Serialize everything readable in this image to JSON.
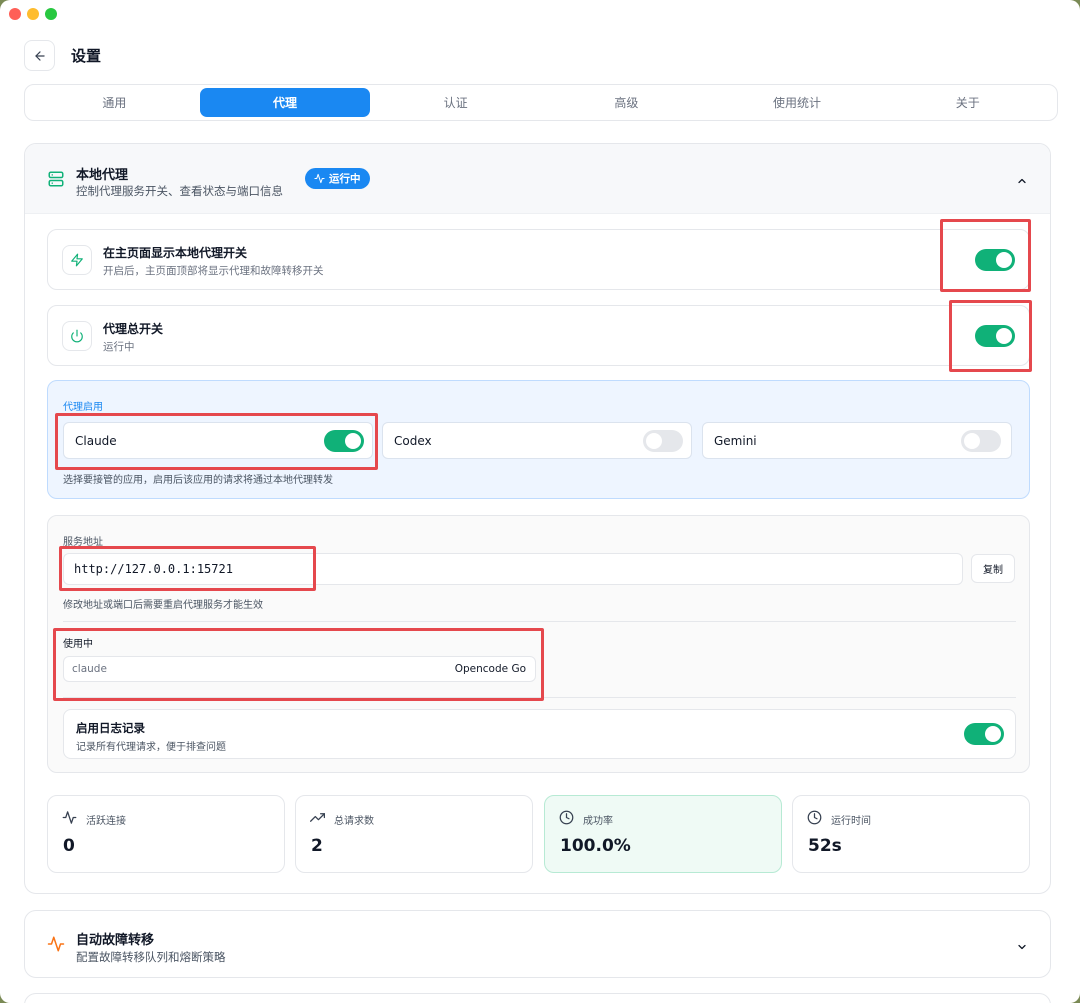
{
  "window": {
    "title": "设置"
  },
  "header": {
    "back_icon": "arrow-left-icon",
    "title": "设置"
  },
  "tabs": [
    {
      "label": "通用",
      "active": false
    },
    {
      "label": "代理",
      "active": true
    },
    {
      "label": "认证",
      "active": false
    },
    {
      "label": "高级",
      "active": false
    },
    {
      "label": "使用统计",
      "active": false
    },
    {
      "label": "关于",
      "active": false
    }
  ],
  "local_proxy": {
    "icon": "server-icon",
    "title": "本地代理",
    "subtitle": "控制代理服务开关、查看状态与端口信息",
    "badge": "运行中",
    "show_toggle": {
      "icon": "zap-icon",
      "title": "在主页面显示本地代理开关",
      "subtitle": "开启后，主页面顶部将显示代理和故障转移开关",
      "enabled": true
    },
    "master_switch": {
      "icon": "power-icon",
      "title": "代理总开关",
      "subtitle": "运行中",
      "enabled": true
    },
    "apps": {
      "label": "代理启用",
      "items": [
        {
          "name": "Claude",
          "enabled": true
        },
        {
          "name": "Codex",
          "enabled": false
        },
        {
          "name": "Gemini",
          "enabled": false
        }
      ],
      "hint": "选择要接管的应用，启用后该应用的请求将通过本地代理转发"
    },
    "service": {
      "label": "服务地址",
      "address": "http://127.0.0.1:15721",
      "copy_label": "复制",
      "hint": "修改地址或端口后需要重启代理服务才能生效",
      "in_use_label": "使用中",
      "in_use": {
        "app": "claude",
        "provider": "Opencode Go"
      },
      "log": {
        "title": "启用日志记录",
        "subtitle": "记录所有代理请求，便于排查问题",
        "enabled": true
      }
    },
    "stats": [
      {
        "icon": "activity-icon",
        "label": "活跃连接",
        "value": "0"
      },
      {
        "icon": "trending-up-icon",
        "label": "总请求数",
        "value": "2"
      },
      {
        "icon": "clock-icon",
        "label": "成功率",
        "value": "100.0%"
      },
      {
        "icon": "clock-icon",
        "label": "运行时间",
        "value": "52s"
      }
    ]
  },
  "failover": {
    "icon": "activity-icon",
    "title": "自动故障转移",
    "subtitle": "配置故障转移队列和熔断策略"
  },
  "colors": {
    "accent": "#1a88f2",
    "toggle_on": "#10b178",
    "highlight": "#e5484d",
    "failover_icon": "#f97316"
  }
}
